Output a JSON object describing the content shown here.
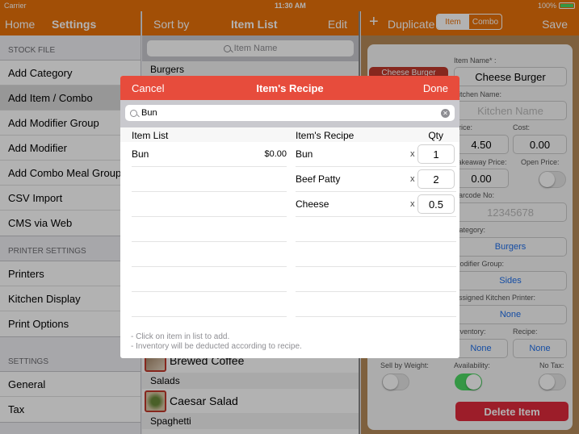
{
  "status_bar": {
    "carrier": "Carrier",
    "wifi_icon": "wifi-icon",
    "time": "11:30 AM",
    "battery": "100%"
  },
  "left_pane": {
    "nav": {
      "home": "Home",
      "title": "Settings"
    },
    "sections": [
      {
        "header": "STOCK FILE",
        "items": [
          "Add Category",
          "Add Item / Combo",
          "Add Modifier Group",
          "Add Modifier",
          "Add Combo Meal Group",
          "CSV Import",
          "CMS via Web"
        ],
        "selected": "Add Item / Combo"
      },
      {
        "header": "PRINTER SETTINGS",
        "items": [
          "Printers",
          "Kitchen Display",
          "Print Options"
        ]
      },
      {
        "header": "SETTINGS",
        "items": [
          "General",
          "Tax"
        ]
      }
    ]
  },
  "mid_pane": {
    "nav": {
      "sort": "Sort by",
      "title": "Item List",
      "edit": "Edit"
    },
    "search_placeholder": "Item Name",
    "top_category": "Burgers",
    "visible_rows": [
      {
        "type": "item",
        "name": "Brewed Coffee"
      },
      {
        "type": "category",
        "name": "Salads"
      },
      {
        "type": "item",
        "name": "Caesar Salad"
      },
      {
        "type": "category",
        "name": "Spaghetti"
      }
    ]
  },
  "right_pane": {
    "nav": {
      "add": "+",
      "duplicate": "Duplicate",
      "seg_item": "Item",
      "seg_combo": "Combo",
      "save": "Save"
    },
    "tag": "Cheese Burger",
    "fields": {
      "item_name_label": "Item Name* :",
      "item_name": "Cheese Burger",
      "kitchen_name_label": "Kitchen Name:",
      "kitchen_name_placeholder": "Kitchen Name",
      "price_label": "Price:",
      "price": "4.50",
      "cost_label": "Cost:",
      "cost": "0.00",
      "takeaway_label": "Takeaway Price:",
      "takeaway": "0.00",
      "open_price_label": "Open Price:",
      "open_price_on": false,
      "barcode_label": "Barcode No:",
      "barcode_placeholder": "12345678",
      "category_label": "Category:",
      "category": "Burgers",
      "modifier_label": "Modifier Group:",
      "modifier": "Sides",
      "printer_label": "Assigned Kitchen Printer:",
      "printer": "None",
      "inventory_label": "Inventory:",
      "inventory": "None",
      "recipe_label": "Recipe:",
      "recipe": "None",
      "weight_label": "Sell by Weight:",
      "weight_on": false,
      "availability_label": "Availability:",
      "availability_on": true,
      "notax_label": "No Tax:",
      "notax_on": false
    },
    "delete": "Delete Item"
  },
  "modal": {
    "cancel": "Cancel",
    "title": "Item's Recipe",
    "done": "Done",
    "search_value": "Bun",
    "col_list": "Item List",
    "col_recipe": "Item's Recipe",
    "col_qty": "Qty",
    "list_items": [
      {
        "name": "Bun",
        "price": "$0.00"
      }
    ],
    "recipe_items": [
      {
        "name": "Bun",
        "qty": "1"
      },
      {
        "name": "Beef Patty",
        "qty": "2"
      },
      {
        "name": "Cheese",
        "qty": "0.5"
      }
    ],
    "multiplier": "x",
    "notes": [
      "- Click on item in list to add.",
      "- Inventory will be deducted according to recipe."
    ]
  }
}
